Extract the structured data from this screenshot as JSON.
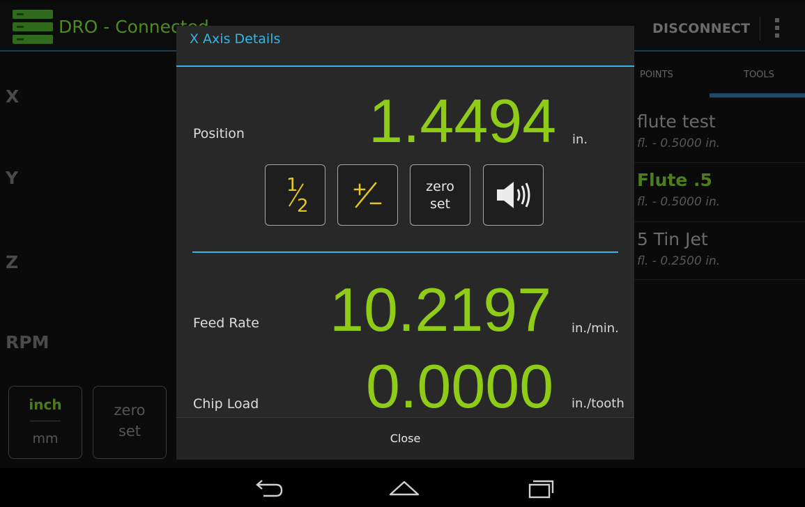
{
  "app": {
    "title": "DRO - Connected",
    "disconnect_label": "DISCONNECT",
    "axis_labels": [
      "X",
      "Y",
      "Z",
      "RPM"
    ],
    "unit_toggle": {
      "selected": "inch",
      "other": "mm"
    },
    "zero_set": {
      "line1": "zero",
      "line2": "set"
    },
    "tabs": [
      {
        "label": "POINTS"
      },
      {
        "label": "TOOLS",
        "selected": true
      }
    ],
    "tools": [
      {
        "name": "flute test",
        "detail": "fl. - 0.5000 in."
      },
      {
        "name": "Flute .5",
        "detail": "fl. - 0.5000 in.",
        "selected": true
      },
      {
        "name": "5 Tin Jet",
        "detail": "fl. - 0.2500 in."
      }
    ]
  },
  "dialog": {
    "title": "X Axis Details",
    "position": {
      "label": "Position",
      "value": "1.4494",
      "unit": "in."
    },
    "controls": {
      "half": {
        "numerator": "1",
        "denominator": "2"
      },
      "sign_icon": "plus-minus-icon",
      "zero_set": {
        "line1": "zero",
        "line2": "set"
      },
      "sound_icon": "speaker-icon"
    },
    "feed_rate": {
      "label": "Feed Rate",
      "value": "10.2197",
      "unit": "in./min."
    },
    "chip_load": {
      "label": "Chip Load",
      "value": "0.0000",
      "unit": "in./tooth"
    },
    "close_label": "Close"
  },
  "navbar": {
    "icons": [
      "back-icon",
      "home-icon",
      "recent-apps-icon"
    ]
  },
  "colors": {
    "accent": "#33b5e5",
    "value_green": "#8fcc17",
    "fraction_yellow": "#e6c81c",
    "dialog_bg": "#282828"
  }
}
